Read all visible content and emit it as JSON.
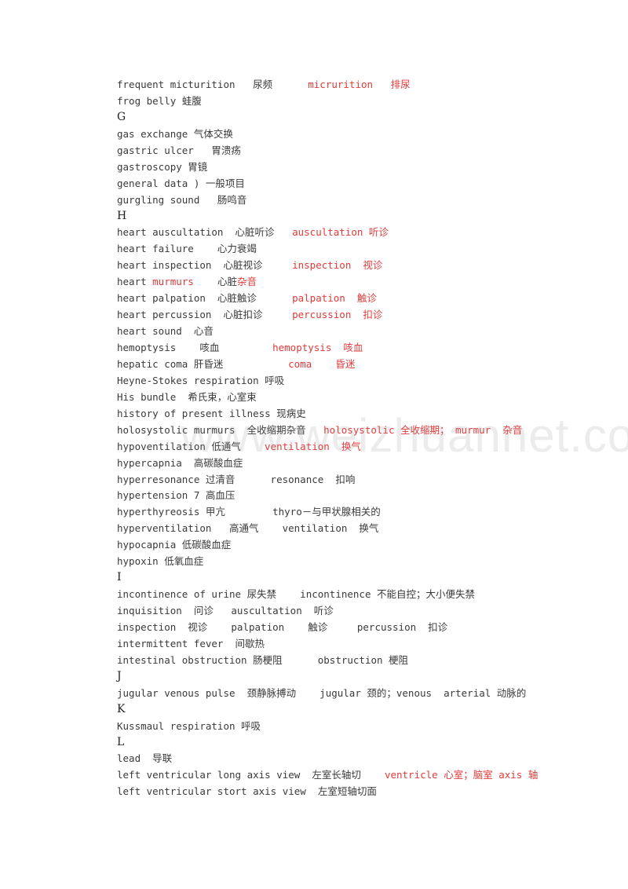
{
  "document": {
    "watermark": "www.weizhuannet.com",
    "lines": [
      {
        "type": "entry",
        "segments": [
          {
            "t": "frequent micturition   尿频      "
          },
          {
            "t": "micrurition   排尿",
            "red": true
          }
        ]
      },
      {
        "type": "entry",
        "segments": [
          {
            "t": "frog belly 蛙腹"
          }
        ]
      },
      {
        "type": "letter",
        "segments": [
          {
            "t": "G"
          }
        ]
      },
      {
        "type": "entry",
        "segments": [
          {
            "t": "gas exchange 气体交换"
          }
        ]
      },
      {
        "type": "entry",
        "segments": [
          {
            "t": "gastric ulcer   胃溃疡"
          }
        ]
      },
      {
        "type": "entry",
        "segments": [
          {
            "t": "gastroscopy 胃镜"
          }
        ]
      },
      {
        "type": "entry",
        "segments": [
          {
            "t": "general data ) 一般项目"
          }
        ]
      },
      {
        "type": "entry",
        "segments": [
          {
            "t": "gurgling sound   肠鸣音"
          }
        ]
      },
      {
        "type": "letter",
        "segments": [
          {
            "t": "H"
          }
        ]
      },
      {
        "type": "entry",
        "segments": [
          {
            "t": "heart auscultation  心脏听诊   "
          },
          {
            "t": "auscultation 听诊",
            "red": true
          }
        ]
      },
      {
        "type": "entry",
        "segments": [
          {
            "t": "heart failure    心力衰竭"
          }
        ]
      },
      {
        "type": "entry",
        "segments": [
          {
            "t": "heart inspection  心脏视诊     "
          },
          {
            "t": "inspection  视诊",
            "red": true
          }
        ]
      },
      {
        "type": "entry",
        "segments": [
          {
            "t": "heart "
          },
          {
            "t": "murmurs",
            "red": true
          },
          {
            "t": "    心脏"
          },
          {
            "t": "杂音",
            "red": true
          }
        ]
      },
      {
        "type": "entry",
        "segments": [
          {
            "t": "heart palpation  心脏触诊      "
          },
          {
            "t": "palpation  触诊",
            "red": true
          }
        ]
      },
      {
        "type": "entry",
        "segments": [
          {
            "t": "heart percussion  心脏扣诊     "
          },
          {
            "t": "percussion  扣诊",
            "red": true
          }
        ]
      },
      {
        "type": "entry",
        "segments": [
          {
            "t": "heart sound  心音"
          }
        ]
      },
      {
        "type": "entry",
        "segments": [
          {
            "t": "hemoptysis    咳血         "
          },
          {
            "t": "hemoptysis  咳血",
            "red": true
          }
        ]
      },
      {
        "type": "entry",
        "segments": [
          {
            "t": "hepatic coma 肝昏迷           "
          },
          {
            "t": "coma    昏迷",
            "red": true
          }
        ]
      },
      {
        "type": "entry",
        "segments": [
          {
            "t": "Heyne-Stokes respiration 呼吸"
          }
        ]
      },
      {
        "type": "entry",
        "segments": [
          {
            "t": "His bundle  希氏束，心室束"
          }
        ]
      },
      {
        "type": "entry",
        "segments": [
          {
            "t": "history of present illness 现病史"
          }
        ]
      },
      {
        "type": "entry",
        "segments": [
          {
            "t": "holosystolic murmurs  全收缩期杂音   "
          },
          {
            "t": "holosystolic 全收缩期； murmur  杂音",
            "red": true
          }
        ]
      },
      {
        "type": "entry",
        "segments": [
          {
            "t": "hypoventilation 低通气    "
          },
          {
            "t": "ventilation  换气",
            "red": true
          }
        ]
      },
      {
        "type": "entry",
        "segments": [
          {
            "t": "hypercapnia  高碳酸血症"
          }
        ]
      },
      {
        "type": "entry",
        "segments": [
          {
            "t": "hyperresonance 过清音      resonance  扣响"
          }
        ]
      },
      {
        "type": "entry",
        "segments": [
          {
            "t": "hypertension 7 高血压"
          }
        ]
      },
      {
        "type": "entry",
        "segments": [
          {
            "t": "hyperthyreosis 甲亢        thyro－与甲状腺相关的"
          }
        ]
      },
      {
        "type": "entry",
        "segments": [
          {
            "t": "hyperventilation   高通气    ventilation  换气"
          }
        ]
      },
      {
        "type": "entry",
        "segments": [
          {
            "t": "hypocapnia 低碳酸血症"
          }
        ]
      },
      {
        "type": "entry",
        "segments": [
          {
            "t": "hypoxin 低氧血症"
          }
        ]
      },
      {
        "type": "letter",
        "segments": [
          {
            "t": "I"
          }
        ]
      },
      {
        "type": "entry",
        "segments": [
          {
            "t": "incontinence of urine 尿失禁    incontinence 不能自控；大小便失禁"
          }
        ]
      },
      {
        "type": "entry",
        "segments": [
          {
            "t": "inquisition  问诊   auscultation  听诊"
          }
        ]
      },
      {
        "type": "entry",
        "segments": [
          {
            "t": "inspection  视诊    palpation    触诊     percussion  扣诊"
          }
        ]
      },
      {
        "type": "entry",
        "segments": [
          {
            "t": "intermittent fever  间歇热"
          }
        ]
      },
      {
        "type": "entry",
        "segments": [
          {
            "t": "intestinal obstruction 肠梗阻      obstruction 梗阻"
          }
        ]
      },
      {
        "type": "letter",
        "segments": [
          {
            "t": "J"
          }
        ]
      },
      {
        "type": "entry",
        "segments": [
          {
            "t": "jugular venous pulse  颈静脉搏动    jugular 颈的；venous  arterial 动脉的"
          }
        ]
      },
      {
        "type": "letter",
        "segments": [
          {
            "t": "K"
          }
        ]
      },
      {
        "type": "entry",
        "segments": [
          {
            "t": "Kussmaul respiration 呼吸"
          }
        ]
      },
      {
        "type": "letter",
        "segments": [
          {
            "t": "L"
          }
        ]
      },
      {
        "type": "entry",
        "segments": [
          {
            "t": "lead  导联"
          }
        ]
      },
      {
        "type": "entry",
        "segments": [
          {
            "t": "left ventricular long axis view  左室长轴切    "
          },
          {
            "t": "ventricle 心室；脑室 axis 轴",
            "red": true
          }
        ]
      },
      {
        "type": "entry",
        "segments": [
          {
            "t": "left ventricular stort axis view  左室短轴切面"
          }
        ]
      }
    ]
  }
}
